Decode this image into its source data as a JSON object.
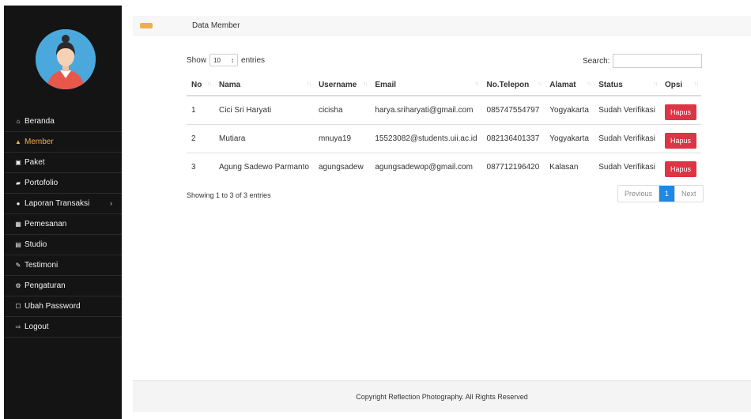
{
  "sidebar": {
    "items": [
      {
        "label": "Beranda",
        "icon": "home-icon",
        "glyph": "⌂"
      },
      {
        "label": "Member",
        "icon": "user-icon",
        "glyph": "▲"
      },
      {
        "label": "Paket",
        "icon": "image-icon",
        "glyph": "▣"
      },
      {
        "label": "Portofolio",
        "icon": "book-icon",
        "glyph": "▰"
      },
      {
        "label": "Laporan Transaksi",
        "icon": "globe-icon",
        "glyph": "●",
        "caret": "›"
      },
      {
        "label": "Pemesanan",
        "icon": "calendar-icon",
        "glyph": "▦"
      },
      {
        "label": "Studio",
        "icon": "film-icon",
        "glyph": "▤"
      },
      {
        "label": "Testimoni",
        "icon": "pencil-icon",
        "glyph": "✎"
      },
      {
        "label": "Pengaturan",
        "icon": "gear-icon",
        "glyph": "⚙"
      },
      {
        "label": "Ubah Password",
        "icon": "edit-icon",
        "glyph": "☐"
      },
      {
        "label": "Logout",
        "icon": "logout-icon",
        "glyph": "⇨"
      }
    ],
    "active_index": 1,
    "active_color": "#f0ad4e"
  },
  "header": {
    "title": "Data Member",
    "toggle_color": "#f0ad4e"
  },
  "controls": {
    "show_label": "Show",
    "entries_value": "10",
    "entries_label": "entries",
    "search_label": "Search:",
    "search_value": ""
  },
  "table": {
    "columns": [
      "No",
      "Nama",
      "Username",
      "Email",
      "No.Telepon",
      "Alamat",
      "Status",
      "Opsi"
    ],
    "rows": [
      {
        "no": "1",
        "nama": "Cici Sri Haryati",
        "username": "cicisha",
        "email": "harya.sriharyati@gmail.com",
        "telepon": "085747554797",
        "alamat": "Yogyakarta",
        "status": "Sudah Verifikasi",
        "action": "Hapus"
      },
      {
        "no": "2",
        "nama": "Mutiara",
        "username": "mnuya19",
        "email": "15523082@students.uii.ac.id",
        "telepon": "082136401337",
        "alamat": "Yogyakarta",
        "status": "Sudah Verifikasi",
        "action": "Hapus"
      },
      {
        "no": "3",
        "nama": "Agung Sadewo Parmanto",
        "username": "agungsadew",
        "email": "agungsadewop@gmail.com",
        "telepon": "087712196420",
        "alamat": "Kalasan",
        "status": "Sudah Verifikasi",
        "action": "Hapus"
      }
    ]
  },
  "pagination": {
    "info": "Showing 1 to 3 of 3 entries",
    "previous": "Previous",
    "current": "1",
    "next": "Next"
  },
  "footer": {
    "text": "Copyright Reflection Photography. All Rights Reserved"
  },
  "colors": {
    "danger": "#dc3545",
    "primary": "#1e88e5",
    "sidebar_bg": "#141414"
  }
}
